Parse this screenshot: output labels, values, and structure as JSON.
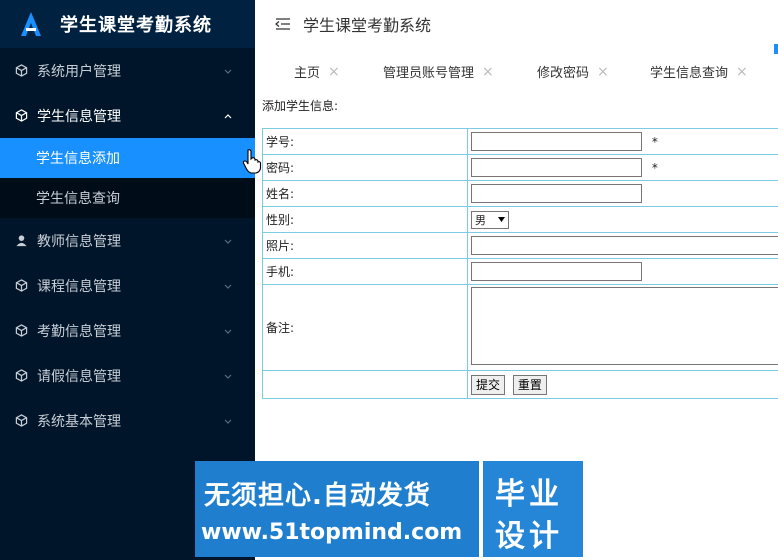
{
  "app": {
    "title": "学生课堂考勤系统",
    "header_title": "学生课堂考勤系统",
    "accent_color": "#1890ff",
    "sidebar_color": "#001529"
  },
  "sidebar": {
    "items": [
      {
        "label": "系统用户管理",
        "icon": "cube-icon"
      },
      {
        "label": "学生信息管理",
        "icon": "cube-icon",
        "open": true,
        "children": [
          {
            "label": "学生信息添加",
            "active": true
          },
          {
            "label": "学生信息查询"
          }
        ]
      },
      {
        "label": "教师信息管理",
        "icon": "user-icon"
      },
      {
        "label": "课程信息管理",
        "icon": "cube-icon"
      },
      {
        "label": "考勤信息管理",
        "icon": "cube-icon"
      },
      {
        "label": "请假信息管理",
        "icon": "cube-icon"
      },
      {
        "label": "系统基本管理",
        "icon": "cube-icon"
      }
    ]
  },
  "tabs": [
    {
      "label": "主页"
    },
    {
      "label": "管理员账号管理"
    },
    {
      "label": "修改密码"
    },
    {
      "label": "学生信息查询"
    }
  ],
  "tab_close": "×",
  "form": {
    "caption": "添加学生信息:",
    "fields": {
      "student_no": {
        "label": "学号:",
        "value": "",
        "required_mark": "*"
      },
      "password": {
        "label": "密码:",
        "value": "",
        "required_mark": "*"
      },
      "name": {
        "label": "姓名:",
        "value": ""
      },
      "gender": {
        "label": "性别:",
        "selected": "男"
      },
      "photo": {
        "label": "照片:",
        "value": ""
      },
      "mobile": {
        "label": "手机:",
        "value": ""
      },
      "memo": {
        "label": "备注:",
        "value": ""
      }
    },
    "submit_label": "提交",
    "reset_label": "重置"
  },
  "banner": {
    "slogan": "无须担心.自动发货",
    "url": "www.51topmind.com",
    "mark_line1": "毕业",
    "mark_line2": "设计"
  }
}
